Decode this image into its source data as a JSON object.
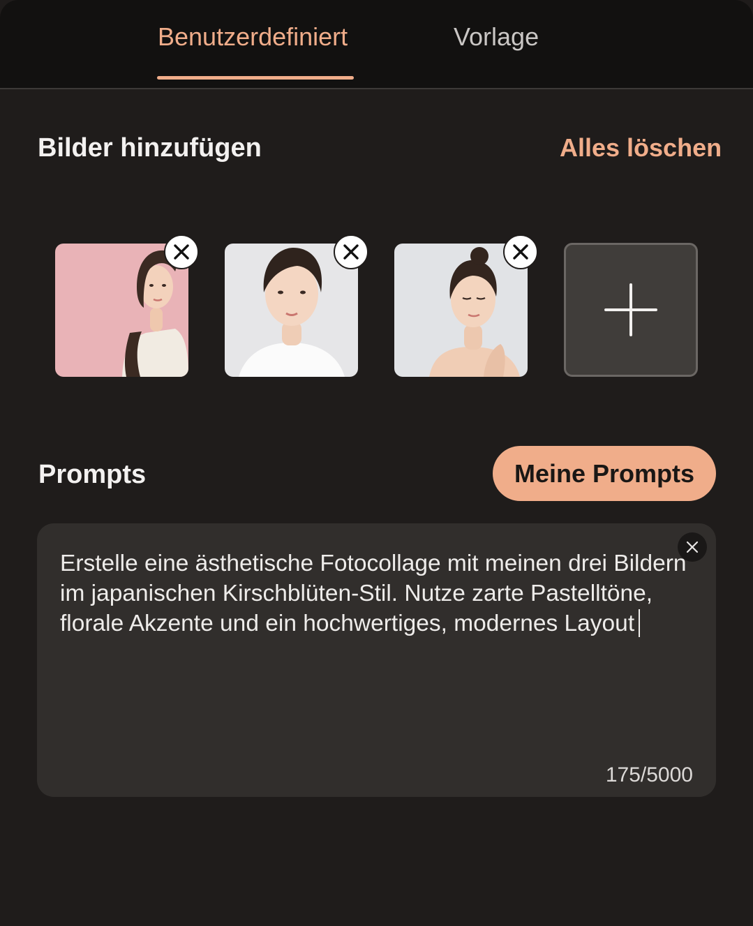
{
  "tabs": {
    "custom_label": "Benutzerdefiniert",
    "template_label": "Vorlage"
  },
  "images_section": {
    "title": "Bilder hinzufügen",
    "clear_all_label": "Alles löschen",
    "thumbnails": [
      {
        "subject": "woman-in-profile-pink-background",
        "background": "#e9b3b7"
      },
      {
        "subject": "woman-portrait-light-background",
        "background": "#e6e6e8"
      },
      {
        "subject": "woman-eyes-closed-light-background",
        "background": "#e1e3e6"
      }
    ],
    "remove_icon": "close-icon",
    "add_icon": "plus-icon"
  },
  "prompts_section": {
    "title": "Prompts",
    "my_prompts_label": "Meine Prompts",
    "prompt_text": "Erstelle eine ästhetische Fotocollage mit meinen drei Bildern im japanischen Kirschblüten-Stil. Nutze zarte Pastelltöne, florale Akzente und ein hochwertiges, modernes Layout",
    "char_count": "175/5000",
    "clear_icon": "close-icon"
  },
  "colors": {
    "accent": "#f0ad8a",
    "background": "#1f1c1b",
    "header_background": "#121110",
    "input_background": "#312e2c"
  }
}
